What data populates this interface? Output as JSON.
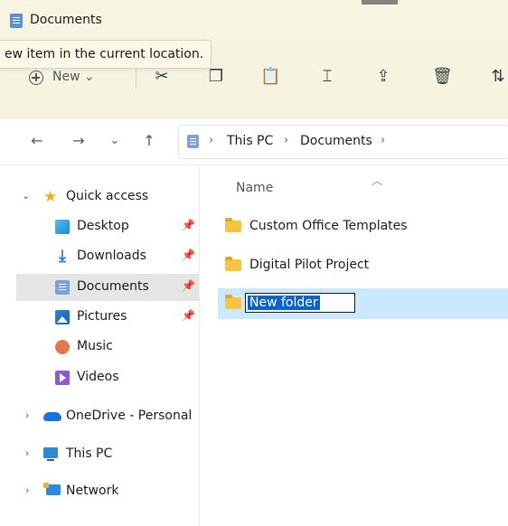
{
  "window": {
    "title": "Documents"
  },
  "tooltip": {
    "text": "ew item in the current location."
  },
  "toolbar": {
    "new_label": "New",
    "new_caret": "⌄"
  },
  "navigation": {
    "back_glyph": "←",
    "forward_glyph": "→",
    "recent_glyph": "⌄",
    "up_glyph": "↑",
    "breadcrumb": [
      "This PC",
      "Documents"
    ],
    "crumb_separator": "›"
  },
  "nav_pane": {
    "quick_access": "Quick access",
    "items": [
      {
        "label": "Desktop",
        "icon": "desktop-icon",
        "pinned": true
      },
      {
        "label": "Downloads",
        "icon": "downloads-icon",
        "pinned": true
      },
      {
        "label": "Documents",
        "icon": "documents-icon",
        "pinned": true,
        "selected": true
      },
      {
        "label": "Pictures",
        "icon": "pictures-icon",
        "pinned": true
      },
      {
        "label": "Music",
        "icon": "music-icon",
        "pinned": false
      },
      {
        "label": "Videos",
        "icon": "videos-icon",
        "pinned": false
      }
    ],
    "roots": [
      {
        "label": "OneDrive - Personal",
        "icon": "onedrive-icon"
      },
      {
        "label": "This PC",
        "icon": "this-pc-icon"
      },
      {
        "label": "Network",
        "icon": "network-icon"
      }
    ]
  },
  "content": {
    "column_header": "Name",
    "files": [
      {
        "name": "Custom Office Templates",
        "type": "folder"
      },
      {
        "name": "Digital Pilot Project",
        "type": "folder"
      },
      {
        "name": "New folder",
        "type": "folder",
        "renaming": true
      }
    ]
  },
  "colors": {
    "selection": "#cce8ff",
    "rename_highlight": "#0a64c8",
    "titlebar": "#f7f5e2"
  }
}
